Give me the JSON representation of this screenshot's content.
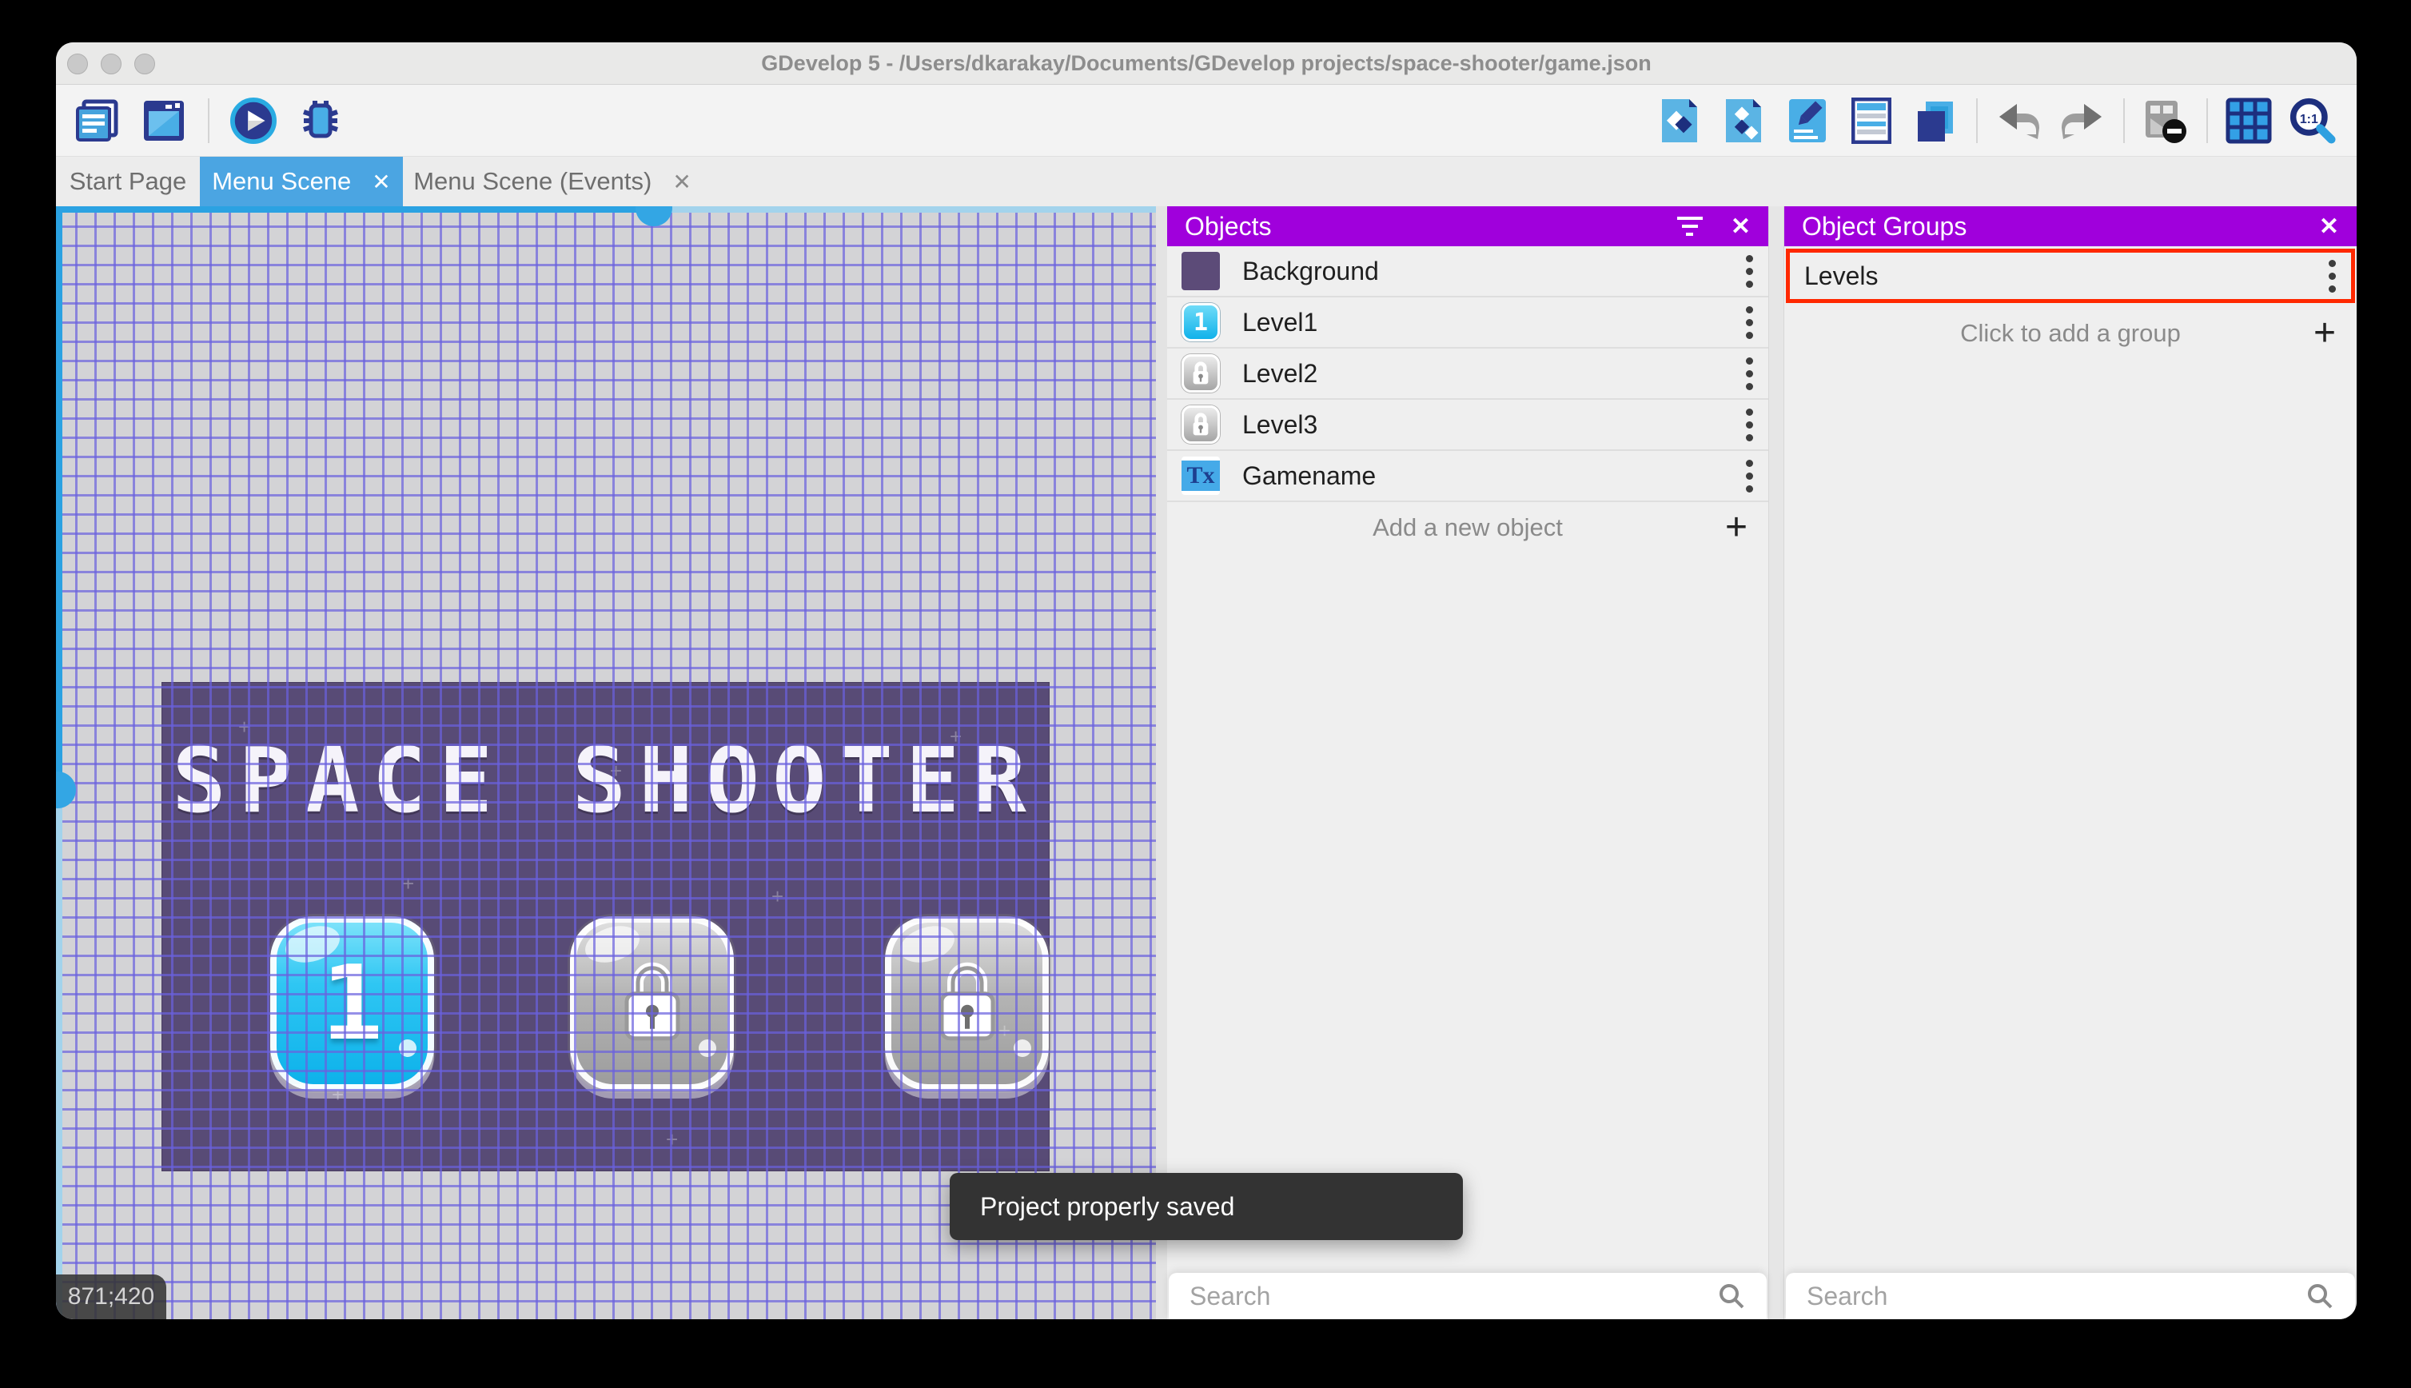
{
  "window": {
    "title": "GDevelop 5 - /Users/dkarakay/Documents/GDevelop projects/space-shooter/game.json",
    "traffic_lights": [
      "close",
      "minimize",
      "zoom"
    ]
  },
  "toolbar": {
    "left_icons": [
      "project-manager",
      "start-page",
      "play-preview",
      "debug"
    ],
    "right_icons": [
      "objects-editor",
      "object-groups-editor",
      "properties",
      "instances-list",
      "layers",
      "undo",
      "redo",
      "toggle-mask",
      "toggle-grid",
      "zoom-1-1"
    ]
  },
  "tabs": [
    {
      "label": "Start Page",
      "active": false,
      "closable": false
    },
    {
      "label": "Menu Scene",
      "active": true,
      "closable": true,
      "close_glyph": "✕"
    },
    {
      "label": "Menu Scene (Events)",
      "active": false,
      "closable": true,
      "close_glyph": "✕"
    }
  ],
  "canvas": {
    "scene_title": "SPACE SHOOTER",
    "coordinates": "871;420",
    "level_buttons": [
      {
        "label": "1",
        "locked": false
      },
      {
        "label": "",
        "locked": true
      },
      {
        "label": "",
        "locked": true
      }
    ]
  },
  "objects_panel": {
    "title": "Objects",
    "items": [
      {
        "name": "Background",
        "thumb": "purple-rectangle"
      },
      {
        "name": "Level1",
        "thumb": "level1-button"
      },
      {
        "name": "Level2",
        "thumb": "locked-button"
      },
      {
        "name": "Level3",
        "thumb": "locked-button"
      },
      {
        "name": "Gamename",
        "thumb": "text-object"
      }
    ],
    "add_label": "Add a new object",
    "search_placeholder": "Search"
  },
  "object_groups_panel": {
    "title": "Object Groups",
    "groups": [
      {
        "name": "Levels",
        "highlighted": true
      }
    ],
    "add_label": "Click to add a group",
    "search_placeholder": "Search"
  },
  "toast": {
    "message": "Project properly saved"
  },
  "colors": {
    "panel_header": "#a000dc",
    "active_tab": "#4ba5e2",
    "highlight_red": "#ff2800",
    "grid_line": "#6a61de",
    "scene_background": "#584b76",
    "toast_background": "#333333"
  }
}
